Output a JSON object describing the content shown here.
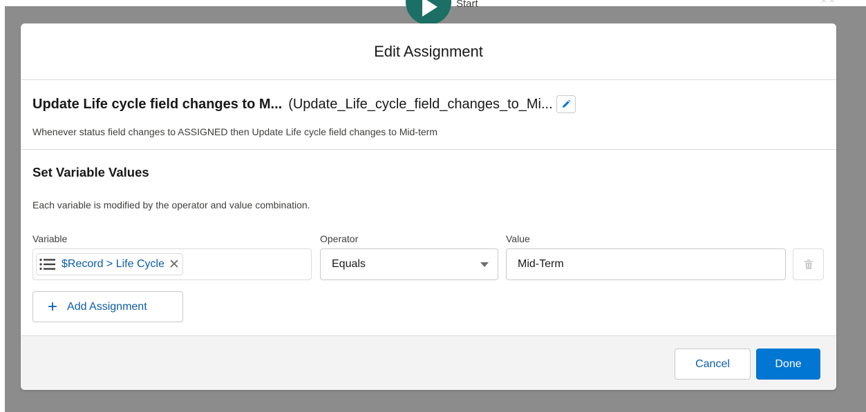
{
  "background": {
    "start_label": "Start",
    "corner_glyph": "⌃⌃"
  },
  "modal": {
    "title": "Edit Assignment"
  },
  "element": {
    "label": "Update Life cycle field changes to M...",
    "api_name": "(Update_Life_cycle_field_changes_to_Mi...",
    "description": "Whenever status field changes to ASSIGNED then Update Life cycle field changes to Mid-term"
  },
  "variables": {
    "section_title": "Set Variable Values",
    "help_text": "Each variable is modified by the operator and value combination.",
    "columns": {
      "variable": "Variable",
      "operator": "Operator",
      "value": "Value"
    },
    "rows": [
      {
        "variable": "$Record > Life Cycle",
        "remove_glyph": "✕",
        "operator": "Equals",
        "value": "Mid-Term"
      }
    ],
    "add_label": "Add Assignment",
    "add_glyph": "+"
  },
  "footer": {
    "cancel_label": "Cancel",
    "done_label": "Done"
  },
  "colors": {
    "brand_blue": "#0176d3",
    "link_blue": "#0b5cab",
    "start_node": "#1c6f64",
    "overlay": "#8c8c8c"
  }
}
